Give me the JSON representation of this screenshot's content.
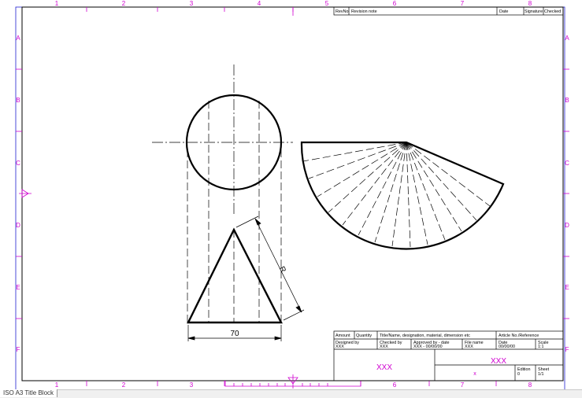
{
  "colors": {
    "zone_marks": "#d000d0",
    "frame": "#2020d0",
    "lines": "#000000"
  },
  "zones": {
    "columns": [
      "1",
      "2",
      "3",
      "4",
      "5",
      "6",
      "7",
      "8"
    ],
    "rows": [
      "A",
      "B",
      "C",
      "D",
      "E",
      "F"
    ]
  },
  "revision_table": {
    "headers": [
      "RevNo",
      "Revision note",
      "Date",
      "Signature",
      "Checked"
    ]
  },
  "title_block": {
    "amount_label": "Amount",
    "quantity_label": "Quantity",
    "title_label": "Title/Name, designation, material, dimension etc",
    "article_label": "Article No./Reference",
    "designed_by_label": "Designed by",
    "designed_by_value": "XXX",
    "checked_by_label": "Checked by",
    "checked_by_value": "XXX",
    "approved_by_label": "Approved by - date",
    "approved_by_value": "XXX - 00/00/00",
    "file_name_label": "File name",
    "file_name_value": "XXX",
    "date_label": "Date",
    "date_value": "00/00/00",
    "scale_label": "Scale",
    "scale_value": "1:1",
    "company_value": "XXX",
    "title_value": "XXX",
    "subtitle_value": "x",
    "edition_label": "Edition",
    "edition_value": "0",
    "sheet_label": "Sheet",
    "sheet_value": "1/1"
  },
  "drawing": {
    "base_dimension": "70",
    "slant_dimension": "R"
  },
  "status_bar": {
    "tab_label": "ISO A3 Title Block"
  }
}
